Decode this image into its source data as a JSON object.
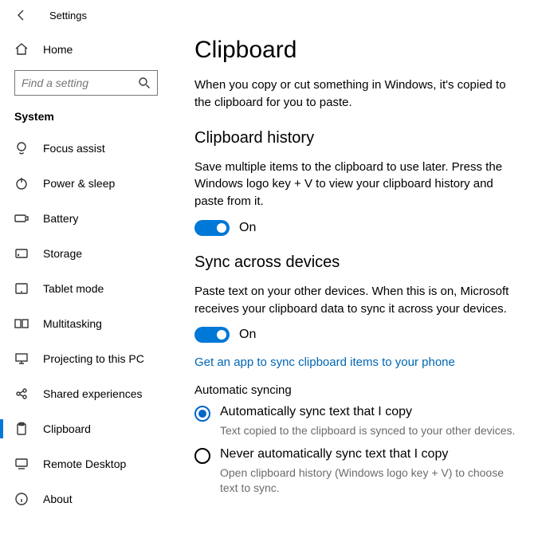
{
  "header": {
    "title": "Settings"
  },
  "sidebar": {
    "home": "Home",
    "search_placeholder": "Find a setting",
    "group": "System",
    "items": [
      {
        "label": "Focus assist"
      },
      {
        "label": "Power & sleep"
      },
      {
        "label": "Battery"
      },
      {
        "label": "Storage"
      },
      {
        "label": "Tablet mode"
      },
      {
        "label": "Multitasking"
      },
      {
        "label": "Projecting to this PC"
      },
      {
        "label": "Shared experiences"
      },
      {
        "label": "Clipboard",
        "selected": true
      },
      {
        "label": "Remote Desktop"
      },
      {
        "label": "About"
      }
    ]
  },
  "main": {
    "title": "Clipboard",
    "intro": "When you copy or cut something in Windows, it's copied to the clipboard for you to paste.",
    "history": {
      "title": "Clipboard history",
      "desc": "Save multiple items to the clipboard to use later. Press the Windows logo key + V to view your clipboard history and paste from it.",
      "toggle_label": "On"
    },
    "sync": {
      "title": "Sync across devices",
      "desc": "Paste text on your other devices. When this is on, Microsoft receives your clipboard data to sync it across your devices.",
      "toggle_label": "On",
      "link": "Get an app to sync clipboard items to your phone",
      "auto_title": "Automatic syncing",
      "opt1": "Automatically sync text that I copy",
      "opt1_sub": "Text copied to the clipboard is synced to your other devices.",
      "opt2": "Never automatically sync text that I copy",
      "opt2_sub": "Open clipboard history (Windows logo key + V) to choose text to sync."
    }
  }
}
